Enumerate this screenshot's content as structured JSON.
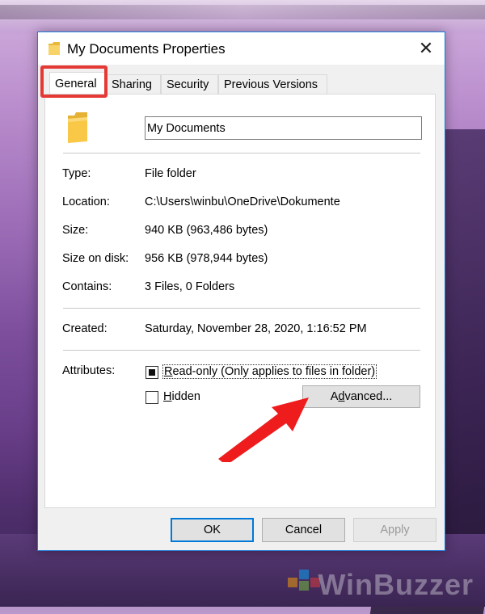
{
  "background": {
    "watermark_text": "WinBuzzer"
  },
  "dialog": {
    "title": "My Documents Properties",
    "close_symbol": "✕",
    "tabs": [
      {
        "label": "General",
        "active": true
      },
      {
        "label": "Sharing",
        "active": false
      },
      {
        "label": "Security",
        "active": false
      },
      {
        "label": "Previous Versions",
        "active": false
      }
    ],
    "name_value": "My Documents",
    "info": {
      "type_label": "Type:",
      "type_value": "File folder",
      "location_label": "Location:",
      "location_value": "C:\\Users\\winbu\\OneDrive\\Dokumente",
      "size_label": "Size:",
      "size_value": "940 KB (963,486 bytes)",
      "size_on_disk_label": "Size on disk:",
      "size_on_disk_value": "956 KB (978,944 bytes)",
      "contains_label": "Contains:",
      "contains_value": "3 Files, 0 Folders",
      "created_label": "Created:",
      "created_value": "Saturday, November 28, 2020, 1:16:52 PM"
    },
    "attributes": {
      "label": "Attributes:",
      "readonly_prefix": "R",
      "readonly_rest": "ead-only (Only applies to files in folder)",
      "readonly_state": "indeterminate",
      "hidden_prefix": "H",
      "hidden_rest": "idden",
      "hidden_checked": false,
      "advanced_prefix": "A",
      "advanced_u": "d",
      "advanced_rest": "vanced..."
    },
    "buttons": {
      "ok": "OK",
      "cancel": "Cancel",
      "apply": "Apply",
      "apply_enabled": false
    },
    "icons": {
      "title": "folder-icon",
      "main": "folder-icon",
      "close": "close-icon"
    },
    "colors": {
      "accent": "#0078d7",
      "highlight": "#e53935",
      "folder": "#f8c846"
    }
  }
}
